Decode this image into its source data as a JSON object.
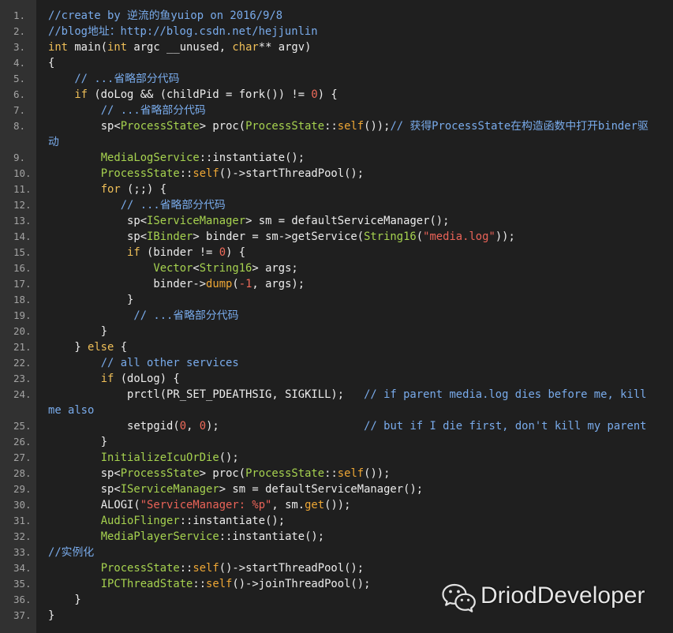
{
  "colors": {
    "background": "#1f1f1f",
    "gutter": "#313131",
    "line_number": "#a3a3a3",
    "watermark": "#e6e6e6"
  },
  "syntax_colors": {
    "p": "#ececec",
    "kw": "#efbf58",
    "ty": "#a6d24f",
    "fn": "#eea735",
    "cm": "#79abeb",
    "num": "#ef6a5a",
    "str": "#ea6358"
  },
  "watermark": {
    "icon": "wechat-icon",
    "text": "DriodDeveloper"
  },
  "lines": [
    {
      "num": "1.",
      "tokens": [
        {
          "cm": "//create by 逆流的鱼yuiop on 2016/9/8"
        }
      ]
    },
    {
      "num": "2.",
      "tokens": [
        {
          "cm": "//blog地址：http://blog.csdn.net/hejjunlin"
        }
      ]
    },
    {
      "num": "3.",
      "tokens": [
        {
          "kw": "int"
        },
        {
          "p": " main("
        },
        {
          "kw": "int"
        },
        {
          "p": " argc __unused, "
        },
        {
          "kw": "char"
        },
        {
          "p": "** argv)"
        }
      ]
    },
    {
      "num": "4.",
      "tokens": [
        {
          "p": "{"
        }
      ]
    },
    {
      "num": "5.",
      "tokens": [
        {
          "p": "    "
        },
        {
          "cm": "// ...省略部分代码"
        }
      ]
    },
    {
      "num": "6.",
      "tokens": [
        {
          "p": "    "
        },
        {
          "kw": "if"
        },
        {
          "p": " (doLog && (childPid = fork()) != "
        },
        {
          "num": "0"
        },
        {
          "p": ") {"
        }
      ]
    },
    {
      "num": "7.",
      "tokens": [
        {
          "p": "        "
        },
        {
          "cm": "// ...省略部分代码"
        }
      ]
    },
    {
      "num": "8.",
      "tokens": [
        {
          "p": "        sp<"
        },
        {
          "ty": "ProcessState"
        },
        {
          "p": "> proc("
        },
        {
          "ty": "ProcessState"
        },
        {
          "p": "::"
        },
        {
          "fn": "self"
        },
        {
          "p": "());"
        },
        {
          "cm": "// 获得ProcessState在构造函数中打开binder驱动"
        }
      ]
    },
    {
      "num": "9.",
      "tokens": [
        {
          "p": "        "
        },
        {
          "ty": "MediaLogService"
        },
        {
          "p": "::instantiate();"
        }
      ]
    },
    {
      "num": "10.",
      "tokens": [
        {
          "p": "        "
        },
        {
          "ty": "ProcessState"
        },
        {
          "p": "::"
        },
        {
          "fn": "self"
        },
        {
          "p": "()->startThreadPool();"
        }
      ]
    },
    {
      "num": "11.",
      "tokens": [
        {
          "p": "        "
        },
        {
          "kw": "for"
        },
        {
          "p": " (;;) {"
        }
      ]
    },
    {
      "num": "12.",
      "tokens": [
        {
          "p": "           "
        },
        {
          "cm": "// ...省略部分代码"
        }
      ]
    },
    {
      "num": "13.",
      "tokens": [
        {
          "p": "            sp<"
        },
        {
          "ty": "IServiceManager"
        },
        {
          "p": "> sm = defaultServiceManager();"
        }
      ]
    },
    {
      "num": "14.",
      "tokens": [
        {
          "p": "            sp<"
        },
        {
          "ty": "IBinder"
        },
        {
          "p": "> binder = sm->getService("
        },
        {
          "ty": "String16"
        },
        {
          "p": "("
        },
        {
          "str": "\"media.log\""
        },
        {
          "p": "));"
        }
      ]
    },
    {
      "num": "15.",
      "tokens": [
        {
          "p": "            "
        },
        {
          "kw": "if"
        },
        {
          "p": " (binder != "
        },
        {
          "num": "0"
        },
        {
          "p": ") {"
        }
      ]
    },
    {
      "num": "16.",
      "tokens": [
        {
          "p": "                "
        },
        {
          "ty": "Vector"
        },
        {
          "p": "<"
        },
        {
          "ty": "String16"
        },
        {
          "p": "> args;"
        }
      ]
    },
    {
      "num": "17.",
      "tokens": [
        {
          "p": "                binder->"
        },
        {
          "fn": "dump"
        },
        {
          "p": "("
        },
        {
          "num": "-1"
        },
        {
          "p": ", args);"
        }
      ]
    },
    {
      "num": "18.",
      "tokens": [
        {
          "p": "            }"
        }
      ]
    },
    {
      "num": "19.",
      "tokens": [
        {
          "p": "             "
        },
        {
          "cm": "// ...省略部分代码"
        }
      ]
    },
    {
      "num": "20.",
      "tokens": [
        {
          "p": "        }"
        }
      ]
    },
    {
      "num": "21.",
      "tokens": [
        {
          "p": "    } "
        },
        {
          "kw": "else"
        },
        {
          "p": " {"
        }
      ]
    },
    {
      "num": "22.",
      "tokens": [
        {
          "p": "        "
        },
        {
          "cm": "// all other services"
        }
      ]
    },
    {
      "num": "23.",
      "tokens": [
        {
          "p": "        "
        },
        {
          "kw": "if"
        },
        {
          "p": " (doLog) {"
        }
      ]
    },
    {
      "num": "24.",
      "tokens": [
        {
          "p": "            prctl(PR_SET_PDEATHSIG, SIGKILL);   "
        },
        {
          "cm": "// if parent media.log dies before me, kill me also"
        }
      ]
    },
    {
      "num": "25.",
      "tokens": [
        {
          "p": "            setpgid("
        },
        {
          "num": "0"
        },
        {
          "p": ", "
        },
        {
          "num": "0"
        },
        {
          "p": ");                      "
        },
        {
          "cm": "// but if I die first, don't kill my parent"
        }
      ]
    },
    {
      "num": "26.",
      "tokens": [
        {
          "p": "        }"
        }
      ]
    },
    {
      "num": "27.",
      "tokens": [
        {
          "p": "        "
        },
        {
          "ty": "InitializeIcuOrDie"
        },
        {
          "p": "();"
        }
      ]
    },
    {
      "num": "28.",
      "tokens": [
        {
          "p": "        sp<"
        },
        {
          "ty": "ProcessState"
        },
        {
          "p": "> proc("
        },
        {
          "ty": "ProcessState"
        },
        {
          "p": "::"
        },
        {
          "fn": "self"
        },
        {
          "p": "());"
        }
      ]
    },
    {
      "num": "29.",
      "tokens": [
        {
          "p": "        sp<"
        },
        {
          "ty": "IServiceManager"
        },
        {
          "p": "> sm = defaultServiceManager();"
        }
      ]
    },
    {
      "num": "30.",
      "tokens": [
        {
          "p": "        ALOGI("
        },
        {
          "str": "\"ServiceManager: %p\""
        },
        {
          "p": ", sm."
        },
        {
          "fn": "get"
        },
        {
          "p": "());"
        }
      ]
    },
    {
      "num": "31.",
      "tokens": [
        {
          "p": "        "
        },
        {
          "ty": "AudioFlinger"
        },
        {
          "p": "::instantiate();"
        }
      ]
    },
    {
      "num": "32.",
      "tokens": [
        {
          "p": "        "
        },
        {
          "ty": "MediaPlayerService"
        },
        {
          "p": "::instantiate();"
        }
      ]
    },
    {
      "num": "33.",
      "tokens": [
        {
          "cm": "//实例化"
        }
      ]
    },
    {
      "num": "34.",
      "tokens": [
        {
          "p": "        "
        },
        {
          "ty": "ProcessState"
        },
        {
          "p": "::"
        },
        {
          "fn": "self"
        },
        {
          "p": "()->startThreadPool();"
        }
      ]
    },
    {
      "num": "35.",
      "tokens": [
        {
          "p": "        "
        },
        {
          "ty": "IPCThreadState"
        },
        {
          "p": "::"
        },
        {
          "fn": "self"
        },
        {
          "p": "()->joinThreadPool();"
        }
      ]
    },
    {
      "num": "36.",
      "tokens": [
        {
          "p": "    }"
        }
      ]
    },
    {
      "num": "37.",
      "tokens": [
        {
          "p": "}"
        }
      ]
    }
  ]
}
